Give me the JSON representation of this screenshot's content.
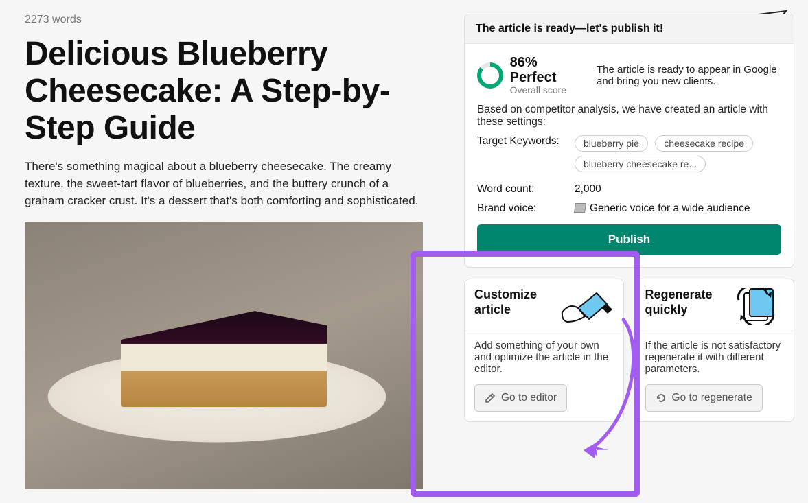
{
  "word_count": "2273 words",
  "title": "Delicious Blueberry Cheesecake: A Step-by-Step Guide",
  "intro": "There's something magical about a blueberry cheesecake. The creamy texture, the sweet-tart flavor of blueberries, and the buttery crunch of a graham cracker crust. It's a dessert that's both comforting and sophisticated.",
  "ready": {
    "header": "The article is ready—let's publish it!",
    "score_pct": "86% Perfect",
    "score_label": "Overall score",
    "summary": "The article is ready to appear in Google and bring you new clients.",
    "analysis": "Based on competitor analysis, we have created an article with these settings:",
    "keywords_label": "Target Keywords:",
    "keywords": [
      "blueberry pie",
      "cheesecake recipe",
      "blueberry cheesecake re..."
    ],
    "wordcount_label": "Word count:",
    "wordcount_value": "2,000",
    "voice_label": "Brand voice:",
    "voice_value": "Generic voice for a wide audience",
    "publish_btn": "Publish"
  },
  "customize": {
    "title": "Customize article",
    "body": "Add something of your own and optimize the article in the editor.",
    "btn": "Go to editor"
  },
  "regen": {
    "title": "Regenerate quickly",
    "body": "If the article is not satisfactory regenerate it with different parameters.",
    "btn": "Go to regenerate"
  }
}
